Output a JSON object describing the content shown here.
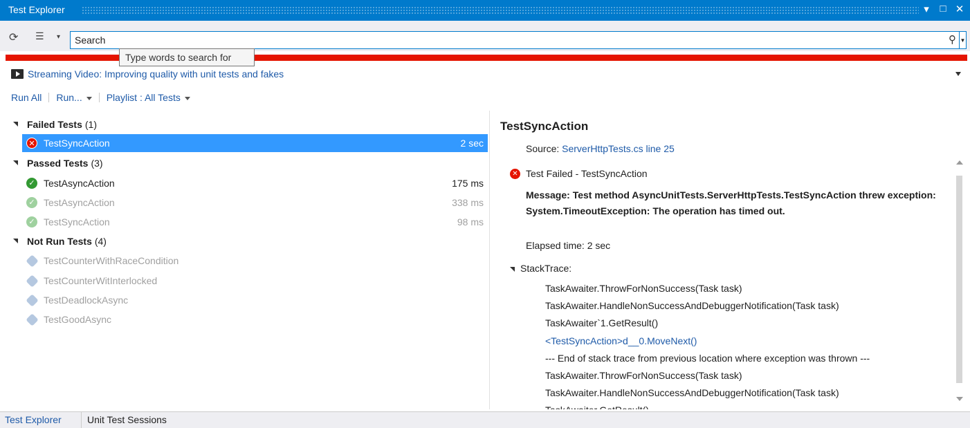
{
  "window": {
    "title": "Test Explorer",
    "controls": [
      "▾",
      "□",
      "✕"
    ]
  },
  "toolbar": {
    "search_value": "Search",
    "tooltip": "Type words to search for"
  },
  "video_link": "Streaming Video: Improving quality with unit tests and fakes",
  "commands": {
    "run_all": "Run All",
    "run": "Run...",
    "playlist": "Playlist : All Tests"
  },
  "groups": {
    "failed": {
      "name": "Failed Tests",
      "count": "(1)"
    },
    "passed": {
      "name": "Passed Tests",
      "count": "(3)"
    },
    "notrun": {
      "name": "Not Run Tests",
      "count": "(4)"
    }
  },
  "failed_tests": [
    {
      "name": "TestSyncAction",
      "time": "2 sec"
    }
  ],
  "passed_tests": [
    {
      "name": "TestAsyncAction",
      "time": "175 ms"
    },
    {
      "name": "TestAsyncAction",
      "time": "338 ms"
    },
    {
      "name": "TestSyncAction",
      "time": "98 ms"
    }
  ],
  "notrun_tests": [
    {
      "name": "TestCounterWithRaceCondition"
    },
    {
      "name": "TestCounterWitInterlocked"
    },
    {
      "name": "TestDeadlockAsync"
    },
    {
      "name": "TestGoodAsync"
    }
  ],
  "detail": {
    "heading": "TestSyncAction",
    "source_label": "Source:",
    "source_link": "ServerHttpTests.cs line 25",
    "status": "Test Failed - TestSyncAction",
    "message_line1": "Message: Test method AsyncUnitTests.ServerHttpTests.TestSyncAction threw exception:",
    "message_line2": "System.TimeoutException: The operation has timed out.",
    "elapsed": "Elapsed time: 2 sec",
    "stack_label": "StackTrace:",
    "frames": [
      "TaskAwaiter.ThrowForNonSuccess(Task task)",
      "TaskAwaiter.HandleNonSuccessAndDebuggerNotification(Task task)",
      "TaskAwaiter`1.GetResult()",
      "<TestSyncAction>d__0.MoveNext()",
      "--- End of stack trace from previous location where exception was thrown ---",
      "TaskAwaiter.ThrowForNonSuccess(Task task)",
      "TaskAwaiter.HandleNonSuccessAndDebuggerNotification(Task task)",
      "TaskAwaiter.GetResult()"
    ]
  },
  "bottom_tabs": {
    "active": "Test Explorer",
    "inactive": "Unit Test Sessions"
  },
  "colors": {
    "accent": "#007acc",
    "fail_bar": "#e51400",
    "selection": "#3399ff",
    "link": "#1e5aa8",
    "pass": "#339933"
  }
}
